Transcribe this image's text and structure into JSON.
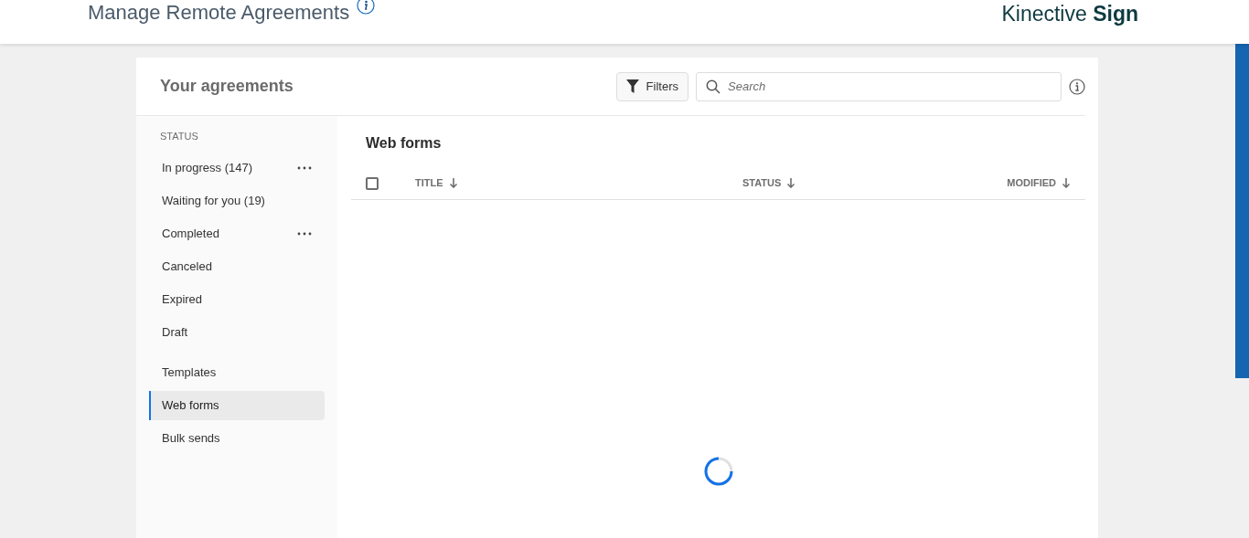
{
  "header": {
    "title": "Manage Remote Agreements",
    "brand_light": "Kinective",
    "brand_bold": "Sign"
  },
  "panel": {
    "title": "Your agreements",
    "filters_button": "Filters",
    "search": {
      "placeholder": "Search"
    }
  },
  "sidebar": {
    "groups": [
      {
        "heading": "STATUS",
        "items": [
          {
            "label": "In progress (147)",
            "selected": false,
            "menu": true
          },
          {
            "label": "Waiting for you (19)",
            "selected": false,
            "menu": false
          },
          {
            "label": "Completed",
            "selected": false,
            "menu": true
          },
          {
            "label": "Canceled",
            "selected": false,
            "menu": false
          },
          {
            "label": "Expired",
            "selected": false,
            "menu": false
          },
          {
            "label": "Draft",
            "selected": false,
            "menu": false
          }
        ]
      },
      {
        "items": [
          {
            "label": "Templates",
            "selected": false,
            "menu": false
          },
          {
            "label": "Web forms",
            "selected": true,
            "menu": false
          },
          {
            "label": "Bulk sends",
            "selected": false,
            "menu": false
          }
        ]
      }
    ]
  },
  "content": {
    "title": "Web forms",
    "select_all": {
      "checked": false
    },
    "columns": [
      {
        "label": "TITLE"
      },
      {
        "label": "STATUS"
      },
      {
        "label": "MODIFIED"
      }
    ],
    "loading": true
  }
}
